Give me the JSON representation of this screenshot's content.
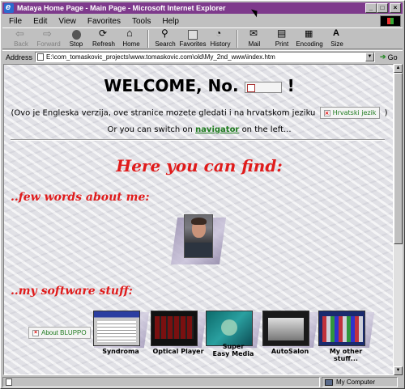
{
  "window": {
    "title": "Mataya Home Page - Main Page - Microsoft Internet Explorer"
  },
  "menu": [
    "File",
    "Edit",
    "View",
    "Favorites",
    "Tools",
    "Help"
  ],
  "toolbar": {
    "back": "Back",
    "forward": "Forward",
    "stop": "Stop",
    "refresh": "Refresh",
    "home": "Home",
    "search": "Search",
    "favorites": "Favorites",
    "history": "History",
    "mail": "Mail",
    "print": "Print",
    "encoding": "Encoding",
    "size": "Size"
  },
  "address": {
    "label": "Address",
    "value": "E:\\com_tomaskovic_projects\\www.tomaskovic.com\\old\\My_2nd_www\\index.htm",
    "go": "Go"
  },
  "page": {
    "welcome": "WELCOME, No.",
    "welcome_suffix": "!",
    "croatian_text": "(Ovo je Engleska verzija, ove stranice mozete gledati i na hrvatskom jeziku",
    "croatian_img_alt": "Hrvatski jezik",
    "croatian_close": ")",
    "switch_prefix": "Or you can switch on",
    "switch_link": "navigator",
    "switch_suffix": "on the left...",
    "find_heading": "Here you can find:",
    "about_heading": "..few words about me:",
    "software_heading": "..my software stuff:",
    "about_bluppo": "About BLUPPO",
    "software": [
      {
        "name": "Syndroma"
      },
      {
        "name": "Optical Player"
      },
      {
        "name": "Super\nEasy Media"
      },
      {
        "name": "AutoSalon"
      },
      {
        "name": "My other stuff..."
      }
    ]
  },
  "status": {
    "zone": "My Computer"
  }
}
